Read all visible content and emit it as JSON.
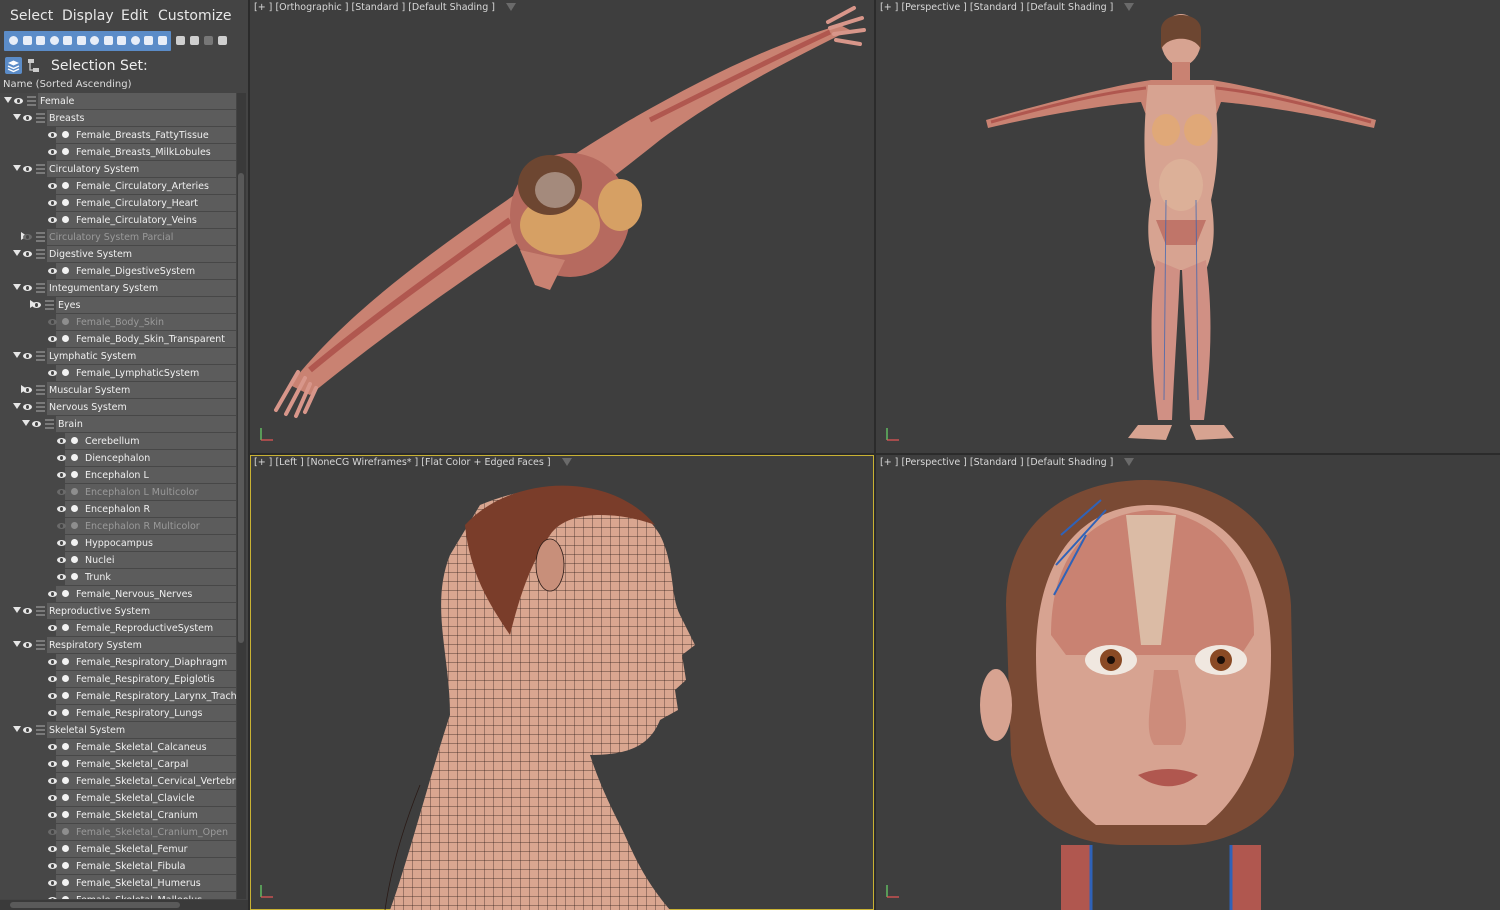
{
  "menu": [
    "Select",
    "Display",
    "Edit",
    "Customize"
  ],
  "toolbar": {
    "icons": [
      "select-geometry-icon",
      "select-shapes-icon",
      "select-lights-icon",
      "select-cameras-icon",
      "select-helpers-icon",
      "select-spacewarps-icon",
      "select-groups-icon",
      "select-xrefs-icon",
      "select-bones-icon",
      "select-particles-icon",
      "select-frozen-icon",
      "select-hidden-icon"
    ],
    "right_icons": [
      "display-children-icon",
      "display-solid-icon",
      "display-none-icon",
      "filter-icon"
    ]
  },
  "selection_set_label": "Selection Set:",
  "column_header": "Name (Sorted Ascending)",
  "tree": [
    {
      "label": "Female",
      "level": 0,
      "type": "layer",
      "expand": "open",
      "visible": true
    },
    {
      "label": "Breasts",
      "level": 1,
      "type": "layer",
      "expand": "open",
      "visible": true
    },
    {
      "label": "Female_Breasts_FattyTissue",
      "level": 2,
      "type": "object",
      "visible": true
    },
    {
      "label": "Female_Breasts_MilkLobules",
      "level": 2,
      "type": "object",
      "visible": true
    },
    {
      "label": "Circulatory System",
      "level": 1,
      "type": "layer",
      "expand": "open",
      "visible": true
    },
    {
      "label": "Female_Circulatory_Arteries",
      "level": 2,
      "type": "object",
      "visible": true
    },
    {
      "label": "Female_Circulatory_Heart",
      "level": 2,
      "type": "object",
      "visible": true
    },
    {
      "label": "Female_Circulatory_Veins",
      "level": 2,
      "type": "object",
      "visible": true
    },
    {
      "label": "Circulatory System Parcial",
      "level": 1,
      "type": "layer",
      "expand": "closed",
      "visible": false
    },
    {
      "label": "Digestive System",
      "level": 1,
      "type": "layer",
      "expand": "open",
      "visible": true
    },
    {
      "label": "Female_DigestiveSystem",
      "level": 2,
      "type": "object",
      "visible": true
    },
    {
      "label": "Integumentary System",
      "level": 1,
      "type": "layer",
      "expand": "open",
      "visible": true
    },
    {
      "label": "Eyes",
      "level": 2,
      "type": "layer",
      "expand": "closed",
      "visible": true
    },
    {
      "label": "Female_Body_Skin",
      "level": 2,
      "type": "object",
      "visible": false
    },
    {
      "label": "Female_Body_Skin_Transparent",
      "level": 2,
      "type": "object",
      "visible": true
    },
    {
      "label": "Lymphatic System",
      "level": 1,
      "type": "layer",
      "expand": "open",
      "visible": true
    },
    {
      "label": "Female_LymphaticSystem",
      "level": 2,
      "type": "object",
      "visible": true
    },
    {
      "label": "Muscular System",
      "level": 1,
      "type": "layer",
      "expand": "closed",
      "visible": true
    },
    {
      "label": "Nervous System",
      "level": 1,
      "type": "layer",
      "expand": "open",
      "visible": true
    },
    {
      "label": "Brain",
      "level": 2,
      "type": "layer",
      "expand": "open",
      "visible": true
    },
    {
      "label": "Cerebellum",
      "level": 3,
      "type": "object",
      "visible": true
    },
    {
      "label": "Diencephalon",
      "level": 3,
      "type": "object",
      "visible": true
    },
    {
      "label": "Encephalon L",
      "level": 3,
      "type": "object",
      "visible": true
    },
    {
      "label": "Encephalon L Multicolor",
      "level": 3,
      "type": "object",
      "visible": false
    },
    {
      "label": "Encephalon R",
      "level": 3,
      "type": "object",
      "visible": true
    },
    {
      "label": "Encephalon R Multicolor",
      "level": 3,
      "type": "object",
      "visible": false
    },
    {
      "label": "Hyppocampus",
      "level": 3,
      "type": "object",
      "visible": true
    },
    {
      "label": "Nuclei",
      "level": 3,
      "type": "object",
      "visible": true
    },
    {
      "label": "Trunk",
      "level": 3,
      "type": "object",
      "visible": true
    },
    {
      "label": "Female_Nervous_Nerves",
      "level": 2,
      "type": "object",
      "visible": true
    },
    {
      "label": "Reproductive System",
      "level": 1,
      "type": "layer",
      "expand": "open",
      "visible": true
    },
    {
      "label": "Female_ReproductiveSystem",
      "level": 2,
      "type": "object",
      "visible": true
    },
    {
      "label": "Respiratory System",
      "level": 1,
      "type": "layer",
      "expand": "open",
      "visible": true
    },
    {
      "label": "Female_Respiratory_Diaphragm",
      "level": 2,
      "type": "object",
      "visible": true
    },
    {
      "label": "Female_Respiratory_Epiglotis",
      "level": 2,
      "type": "object",
      "visible": true
    },
    {
      "label": "Female_Respiratory_Larynx_Trachea_Bron",
      "level": 2,
      "type": "object",
      "visible": true
    },
    {
      "label": "Female_Respiratory_Lungs",
      "level": 2,
      "type": "object",
      "visible": true
    },
    {
      "label": "Skeletal System",
      "level": 1,
      "type": "layer",
      "expand": "open",
      "visible": true
    },
    {
      "label": "Female_Skeletal_Calcaneus",
      "level": 2,
      "type": "object",
      "visible": true
    },
    {
      "label": "Female_Skeletal_Carpal",
      "level": 2,
      "type": "object",
      "visible": true
    },
    {
      "label": "Female_Skeletal_Cervical_Vertebra",
      "level": 2,
      "type": "object",
      "visible": true
    },
    {
      "label": "Female_Skeletal_Clavicle",
      "level": 2,
      "type": "object",
      "visible": true
    },
    {
      "label": "Female_Skeletal_Cranium",
      "level": 2,
      "type": "object",
      "visible": true
    },
    {
      "label": "Female_Skeletal_Cranium_Open",
      "level": 2,
      "type": "object",
      "visible": false
    },
    {
      "label": "Female_Skeletal_Femur",
      "level": 2,
      "type": "object",
      "visible": true
    },
    {
      "label": "Female_Skeletal_Fibula",
      "level": 2,
      "type": "object",
      "visible": true
    },
    {
      "label": "Female_Skeletal_Humerus",
      "level": 2,
      "type": "object",
      "visible": true
    },
    {
      "label": "Female_Skeletal_Malleolus",
      "level": 2,
      "type": "object",
      "visible": true
    }
  ],
  "viewports": [
    {
      "id": "top-left",
      "labels": [
        "[+ ]",
        "[Orthographic ]",
        "[Standard ]",
        "[Default Shading ]"
      ],
      "active": false
    },
    {
      "id": "top-right",
      "labels": [
        "[+ ]",
        "[Perspective ]",
        "[Standard ]",
        "[Default Shading ]"
      ],
      "active": false
    },
    {
      "id": "bottom-left",
      "labels": [
        "[+ ]",
        "[Left ]",
        "[NoneCG Wireframes* ]",
        "[Flat Color + Edged Faces ]"
      ],
      "active": true
    },
    {
      "id": "bottom-right",
      "labels": [
        "[+ ]",
        "[Perspective ]",
        "[Standard ]",
        "[Default Shading ]"
      ],
      "active": false
    }
  ],
  "colors": {
    "panel_bg": "#444444",
    "toolbar_accent": "#5b8cc8",
    "viewport_bg": "#3e3e3e",
    "active_border": "#c9b233",
    "skin": "#d7a391",
    "muscle": "#b95c55",
    "hair": "#6d4631",
    "vein": "#2f62b8"
  }
}
